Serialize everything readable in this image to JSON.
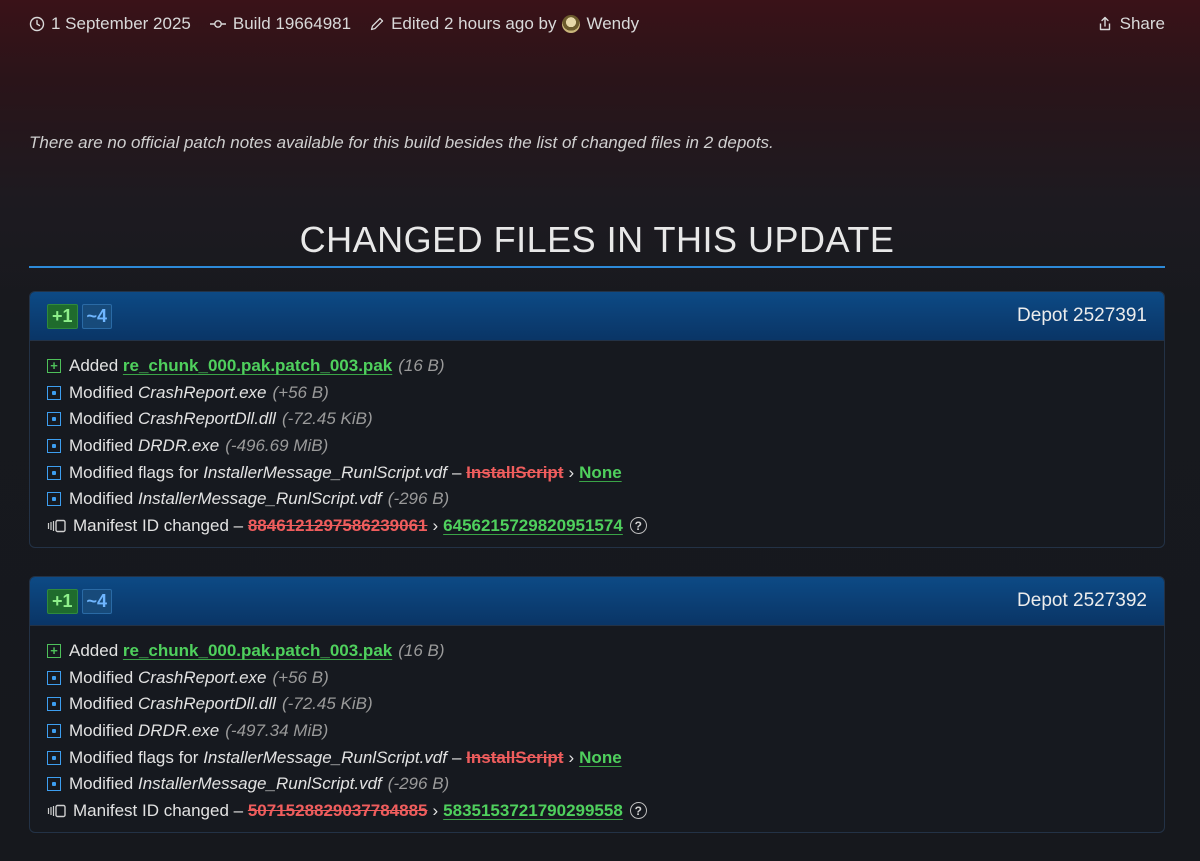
{
  "topbar": {
    "date": "1 September 2025",
    "build": "Build 19664981",
    "edited": "Edited 2 hours ago by",
    "user": "Wendy",
    "share": "Share"
  },
  "notes": "There are no official patch notes available for this build besides the list of changed files in 2 depots.",
  "heading": "CHANGED FILES IN THIS UPDATE",
  "colors": {
    "accent": "#2d8ad8",
    "added": "#4fd05d",
    "removed": "#ef5d5d",
    "header": "#0d4a85"
  },
  "depots": [
    {
      "badge_added": "+1",
      "badge_modified": "~4",
      "title": "Depot 2527391",
      "added": {
        "label": "Added",
        "file": "re_chunk_000.pak.patch_003.pak",
        "size": "(16 B)"
      },
      "modified": [
        {
          "label": "Modified",
          "file": "CrashReport.exe",
          "size": "(+56 B)"
        },
        {
          "label": "Modified",
          "file": "CrashReportDll.dll",
          "size": "(-72.45 KiB)"
        },
        {
          "label": "Modified",
          "file": "DRDR.exe",
          "size": "(-496.69 MiB)"
        }
      ],
      "flags": {
        "label": "Modified flags for",
        "file": "InstallerMessage_RunlScript.vdf",
        "dash": "–",
        "old": "InstallScript",
        "arrow": "›",
        "new": "None"
      },
      "modified_last": {
        "label": "Modified",
        "file": "InstallerMessage_RunlScript.vdf",
        "size": "(-296 B)"
      },
      "manifest": {
        "label": "Manifest ID changed –",
        "old": "8846121297586239061",
        "arrow": "›",
        "new": "6456215729820951574",
        "help": "?"
      }
    },
    {
      "badge_added": "+1",
      "badge_modified": "~4",
      "title": "Depot 2527392",
      "added": {
        "label": "Added",
        "file": "re_chunk_000.pak.patch_003.pak",
        "size": "(16 B)"
      },
      "modified": [
        {
          "label": "Modified",
          "file": "CrashReport.exe",
          "size": "(+56 B)"
        },
        {
          "label": "Modified",
          "file": "CrashReportDll.dll",
          "size": "(-72.45 KiB)"
        },
        {
          "label": "Modified",
          "file": "DRDR.exe",
          "size": "(-497.34 MiB)"
        }
      ],
      "flags": {
        "label": "Modified flags for",
        "file": "InstallerMessage_RunlScript.vdf",
        "dash": "–",
        "old": "InstallScript",
        "arrow": "›",
        "new": "None"
      },
      "modified_last": {
        "label": "Modified",
        "file": "InstallerMessage_RunlScript.vdf",
        "size": "(-296 B)"
      },
      "manifest": {
        "label": "Manifest ID changed –",
        "old": "5071528829037784885",
        "arrow": "›",
        "new": "5835153721790299558",
        "help": "?"
      }
    }
  ]
}
